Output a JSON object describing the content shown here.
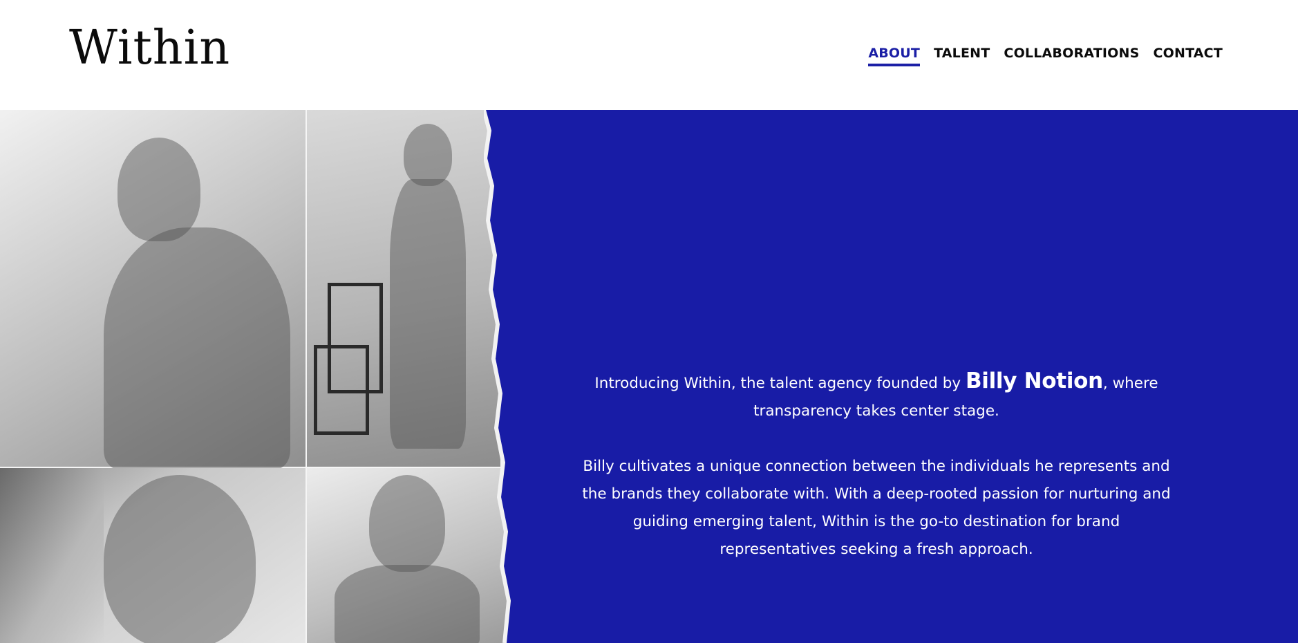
{
  "brand": {
    "logo_text": "Within"
  },
  "nav": {
    "items": [
      {
        "label": "ABOUT",
        "active": true
      },
      {
        "label": "TALENT",
        "active": false
      },
      {
        "label": "COLLABORATIONS",
        "active": false
      },
      {
        "label": "CONTACT",
        "active": false
      }
    ]
  },
  "hero": {
    "intro": {
      "before_name": "Introducing Within, the talent agency founded by ",
      "name": "Billy Notion",
      "after_name": ", where transparency takes center stage."
    },
    "body": "Billy cultivates a unique connection between the individuals he represents and the brands they collaborate with. With a deep-rooted passion for nurturing and guiding emerging talent, Within is the go-to destination for brand representatives seeking a fresh approach."
  },
  "colors": {
    "accent": "#181ca6",
    "nav_active": "#1b1fa6",
    "text_dark": "#0b0b0b",
    "text_light": "#ffffff",
    "header_bg": "#ffffff"
  }
}
